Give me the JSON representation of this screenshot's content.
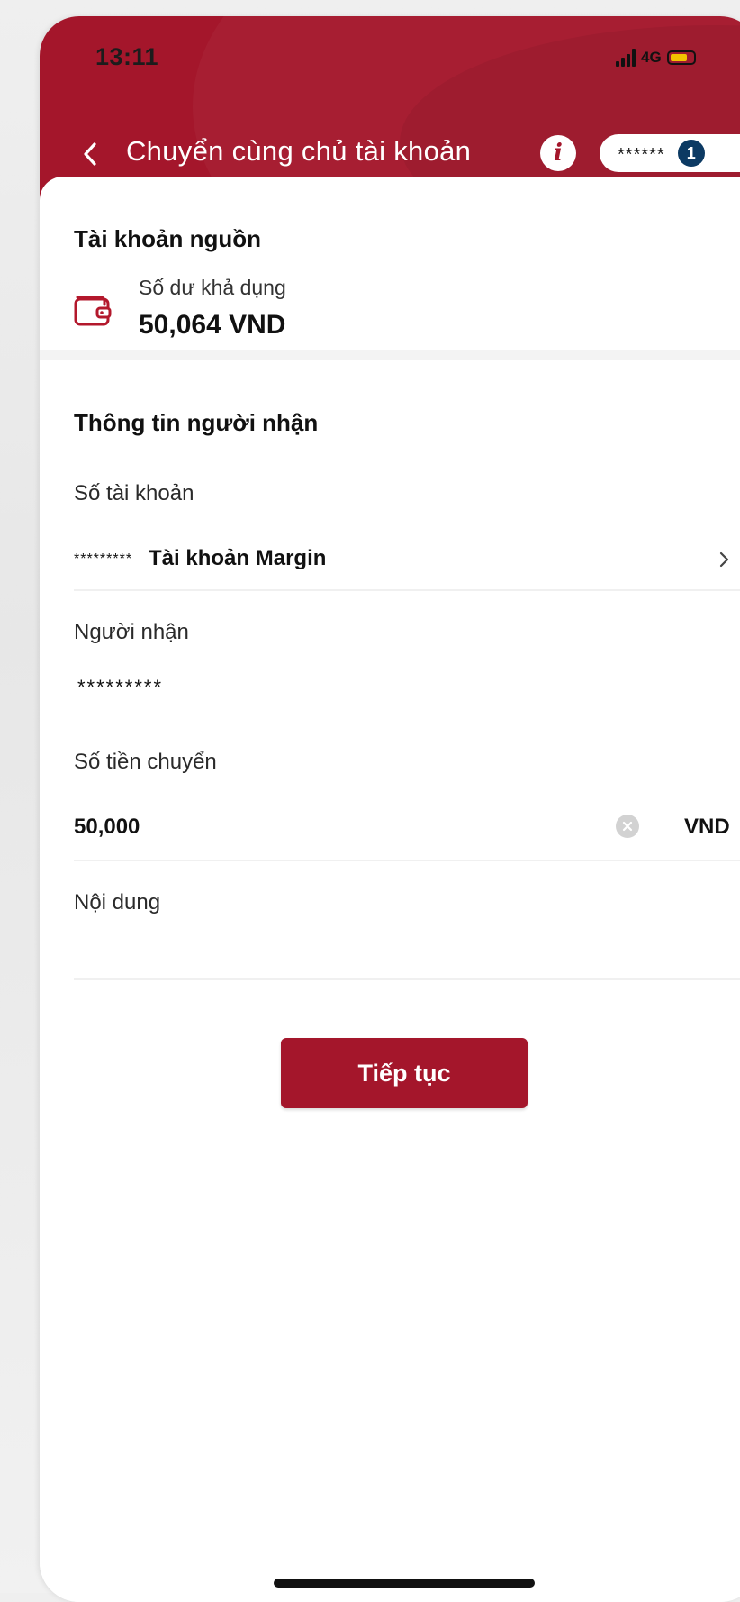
{
  "status_bar": {
    "time": "13:11",
    "network": "4G",
    "battery_level": 0.6,
    "battery_color": "#f2c300"
  },
  "nav": {
    "back_icon": "chevron-left-icon",
    "title": "Chuyển cùng chủ tài khoản",
    "info_icon": "info-icon",
    "account_mask": "******",
    "account_count": "1"
  },
  "source": {
    "section_title": "Tài khoản nguồn",
    "wallet_icon": "wallet-icon",
    "balance_label": "Số dư khả dụng",
    "balance_value": "50,064 VND"
  },
  "recipient": {
    "section_title": "Thông tin người nhận",
    "account_label": "Số tài khoản",
    "account_mask": "*********",
    "account_type": "Tài khoản Margin",
    "recipient_label": "Người nhận",
    "recipient_mask": "*********",
    "amount_label": "Số tiền chuyển",
    "amount_value": "50,000",
    "currency": "VND",
    "content_label": "Nội dung",
    "content_value": ""
  },
  "actions": {
    "continue_label": "Tiếp tục"
  },
  "colors": {
    "brand": "#a4162b",
    "badge": "#0c3a63"
  }
}
